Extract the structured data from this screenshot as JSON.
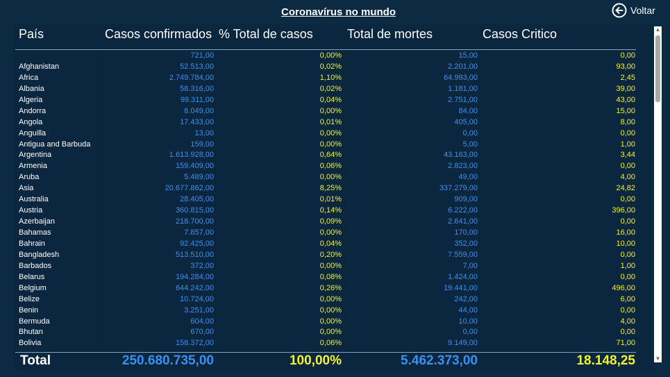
{
  "page": {
    "title": "Coronavírus no mundo",
    "back_label": "Voltar",
    "back_icon": "arrow-left-circle-icon"
  },
  "colors": {
    "background": "#0c2b43",
    "confirmed": "#3b8ff0",
    "percent": "#f2f230",
    "deaths": "#3b8ff0",
    "critical": "#f2f230",
    "text": "#ffffff"
  },
  "table": {
    "headers": [
      "País",
      "Casos confirmados",
      "% Total de casos",
      "Total de mortes",
      "Casos Critico"
    ],
    "rows": [
      {
        "country": "",
        "confirmed": "721,00",
        "pct": "0,00%",
        "deaths": "15,00",
        "critical": "0,00"
      },
      {
        "country": "Afghanistan",
        "confirmed": "52.513,00",
        "pct": "0,02%",
        "deaths": "2.201,00",
        "critical": "93,00"
      },
      {
        "country": "Africa",
        "confirmed": "2.749.784,00",
        "pct": "1,10%",
        "deaths": "64.993,00",
        "critical": "2,45"
      },
      {
        "country": "Albania",
        "confirmed": "58.316,00",
        "pct": "0,02%",
        "deaths": "1.181,00",
        "critical": "39,00"
      },
      {
        "country": "Algeria",
        "confirmed": "99.311,00",
        "pct": "0,04%",
        "deaths": "2.751,00",
        "critical": "43,00"
      },
      {
        "country": "Andorra",
        "confirmed": "8.049,00",
        "pct": "0,00%",
        "deaths": "84,00",
        "critical": "15,00"
      },
      {
        "country": "Angola",
        "confirmed": "17.433,00",
        "pct": "0,01%",
        "deaths": "405,00",
        "critical": "8,00"
      },
      {
        "country": "Anguilla",
        "confirmed": "13,00",
        "pct": "0,00%",
        "deaths": "0,00",
        "critical": "0,00"
      },
      {
        "country": "Antigua and Barbuda",
        "confirmed": "159,00",
        "pct": "0,00%",
        "deaths": "5,00",
        "critical": "1,00"
      },
      {
        "country": "Argentina",
        "confirmed": "1.613.928,00",
        "pct": "0,64%",
        "deaths": "43.163,00",
        "critical": "3,44"
      },
      {
        "country": "Armenia",
        "confirmed": "159.409,00",
        "pct": "0,06%",
        "deaths": "2.823,00",
        "critical": "0,00"
      },
      {
        "country": "Aruba",
        "confirmed": "5.489,00",
        "pct": "0,00%",
        "deaths": "49,00",
        "critical": "4,00"
      },
      {
        "country": "Asia",
        "confirmed": "20.677.862,00",
        "pct": "8,25%",
        "deaths": "337.279,00",
        "critical": "24,82"
      },
      {
        "country": "Australia",
        "confirmed": "28.405,00",
        "pct": "0,01%",
        "deaths": "909,00",
        "critical": "0,00"
      },
      {
        "country": "Austria",
        "confirmed": "360.815,00",
        "pct": "0,14%",
        "deaths": "6.222,00",
        "critical": "396,00"
      },
      {
        "country": "Azerbaijan",
        "confirmed": "218.700,00",
        "pct": "0,09%",
        "deaths": "2.641,00",
        "critical": "0,00"
      },
      {
        "country": "Bahamas",
        "confirmed": "7.857,00",
        "pct": "0,00%",
        "deaths": "170,00",
        "critical": "16,00"
      },
      {
        "country": "Bahrain",
        "confirmed": "92.425,00",
        "pct": "0,04%",
        "deaths": "352,00",
        "critical": "10,00"
      },
      {
        "country": "Bangladesh",
        "confirmed": "513.510,00",
        "pct": "0,20%",
        "deaths": "7.559,00",
        "critical": "0,00"
      },
      {
        "country": "Barbados",
        "confirmed": "372,00",
        "pct": "0,00%",
        "deaths": "7,00",
        "critical": "1,00"
      },
      {
        "country": "Belarus",
        "confirmed": "194.284,00",
        "pct": "0,08%",
        "deaths": "1.424,00",
        "critical": "0,00"
      },
      {
        "country": "Belgium",
        "confirmed": "644.242,00",
        "pct": "0,26%",
        "deaths": "19.441,00",
        "critical": "496,00"
      },
      {
        "country": "Belize",
        "confirmed": "10.724,00",
        "pct": "0,00%",
        "deaths": "242,00",
        "critical": "6,00"
      },
      {
        "country": "Benin",
        "confirmed": "3.251,00",
        "pct": "0,00%",
        "deaths": "44,00",
        "critical": "0,00"
      },
      {
        "country": "Bermuda",
        "confirmed": "604,00",
        "pct": "0,00%",
        "deaths": "10,00",
        "critical": "4,00"
      },
      {
        "country": "Bhutan",
        "confirmed": "670,00",
        "pct": "0,00%",
        "deaths": "0,00",
        "critical": "0,00"
      },
      {
        "country": "Bolivia",
        "confirmed": "158.372,00",
        "pct": "0,06%",
        "deaths": "9.149,00",
        "critical": "71,00"
      }
    ],
    "total": {
      "label": "Total",
      "confirmed": "250.680.735,00",
      "pct": "100,00%",
      "deaths": "5.462.373,00",
      "critical": "18.148,25"
    }
  },
  "scrollbar": {
    "up_icon": "chevron-up-icon",
    "down_icon": "chevron-down-icon"
  }
}
